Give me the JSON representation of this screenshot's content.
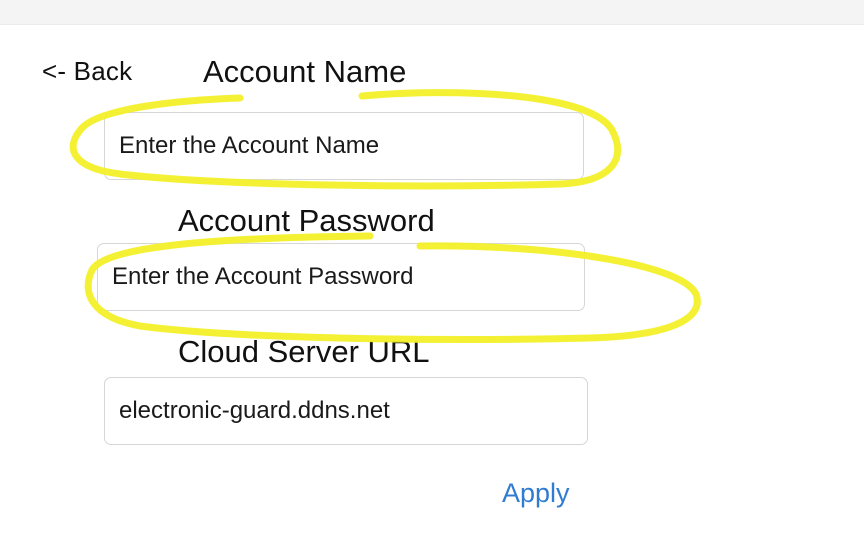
{
  "nav": {
    "back_label": "<- Back"
  },
  "form": {
    "account_name": {
      "label": "Account Name",
      "placeholder": "Enter the Account Name",
      "value": ""
    },
    "account_password": {
      "label": "Account Password",
      "placeholder": "Enter the Account Password",
      "value": ""
    },
    "cloud_server_url": {
      "label": "Cloud Server URL",
      "placeholder": "",
      "value": "electronic-guard.ddns.net"
    },
    "apply_label": "Apply"
  },
  "colors": {
    "link": "#2f7cd1",
    "highlight": "#f3f02a",
    "text": "#111111",
    "field_border": "#d6d6d6"
  }
}
